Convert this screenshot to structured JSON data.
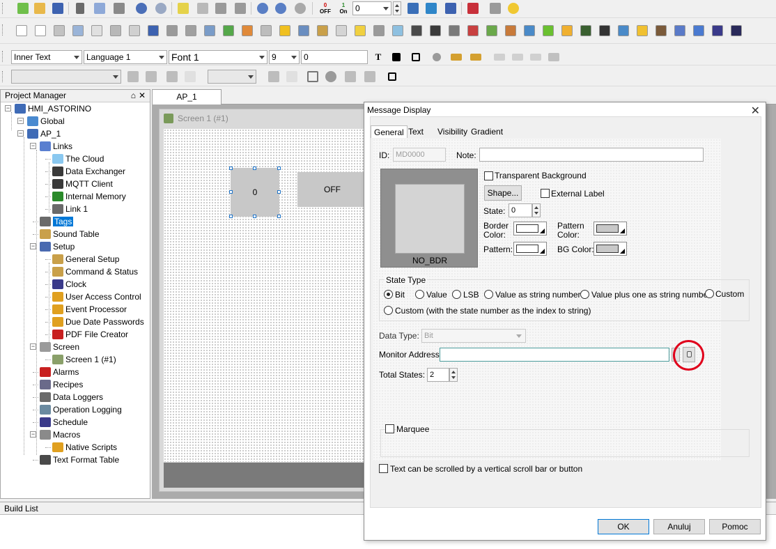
{
  "colors": {
    "accent": "#0078d7",
    "highlight_circle": "#e0001b",
    "widget_gray": "#c8c8c8",
    "canvas_foot": "#7a7a7a"
  },
  "toolbar1": {
    "icons": [
      "new-icon",
      "open-icon",
      "save-icon",
      "cut-icon",
      "copy-icon",
      "paste-icon",
      "undo-icon",
      "redo-icon",
      "add-screen-icon",
      "screen-icon",
      "screen-prev-icon",
      "screen-next-icon",
      "zoom-in-icon",
      "zoom-out-icon",
      "zoom-reset-icon",
      "state-off-icon",
      "state-on-icon"
    ],
    "state_off_label": "OFF",
    "state_off_top": "0",
    "state_on_label": "On",
    "state_on_top": "1",
    "state_combo_value": "0"
  },
  "toolbar3": {
    "text_type": "Inner Text",
    "language": "Language 1",
    "font": "Font 1",
    "font_size": "9",
    "value": "0",
    "bold_label": "T"
  },
  "project_manager": {
    "title": "Project Manager",
    "pin": "⌂",
    "close": "✕",
    "items": [
      {
        "label": "HMI_ASTORINO"
      },
      {
        "label": "Global"
      },
      {
        "label": "AP_1"
      },
      {
        "label": "Links"
      },
      {
        "label": "The Cloud"
      },
      {
        "label": "Data Exchanger"
      },
      {
        "label": "MQTT Client"
      },
      {
        "label": "Internal Memory"
      },
      {
        "label": "Link 1"
      },
      {
        "label": "Tags"
      },
      {
        "label": "Sound Table"
      },
      {
        "label": "Setup"
      },
      {
        "label": "General Setup"
      },
      {
        "label": "Command & Status"
      },
      {
        "label": "Clock"
      },
      {
        "label": "User Access Control"
      },
      {
        "label": "Event Processor"
      },
      {
        "label": "Due Date Passwords"
      },
      {
        "label": "PDF File Creator"
      },
      {
        "label": "Screen"
      },
      {
        "label": "Screen 1 (#1)"
      },
      {
        "label": "Alarms"
      },
      {
        "label": "Recipes"
      },
      {
        "label": "Data Loggers"
      },
      {
        "label": "Operation Logging"
      },
      {
        "label": "Schedule"
      },
      {
        "label": "Macros"
      },
      {
        "label": "Native Scripts"
      },
      {
        "label": "Text Format Table"
      }
    ]
  },
  "doc_tab": "AP_1",
  "screen_window": {
    "title": "Screen 1 (#1)",
    "widget_value": "0",
    "widget_off": "OFF"
  },
  "build_list": {
    "title": "Build List"
  },
  "dialog": {
    "title": "Message Display",
    "close": "✕",
    "tabs": [
      "General",
      "Text",
      "Visibility",
      "Gradient"
    ],
    "id_label": "ID:",
    "id_value": "MD0000",
    "note_label": "Note:",
    "note_value": "",
    "preview_label": "NO_BDR",
    "transparent_bg": "Transparent Background",
    "shape_button": "Shape...",
    "external_label": "External Label",
    "state_label": "State:",
    "state_value": "0",
    "border_color_label": "Border Color:",
    "pattern_color_label": "Pattern Color:",
    "pattern_label": "Pattern:",
    "bg_color_label": "BG Color:",
    "state_type_title": "State Type",
    "state_types": [
      "Bit",
      "Value",
      "LSB",
      "Value as string number",
      "Value plus one as string number",
      "Custom",
      "Custom (with the state number as the index to string)"
    ],
    "selected_state_type": "Bit",
    "data_type_label": "Data Type:",
    "data_type_value": "Bit",
    "monitor_address_label": "Monitor Address:",
    "monitor_address_value": "",
    "total_states_label": "Total States:",
    "total_states_value": "2",
    "marquee_label": "Marquee",
    "scroll_label": "Text can be scrolled by a vertical scroll bar or button",
    "ok_button": "OK",
    "cancel_button": "Anuluj",
    "help_button": "Pomoc"
  }
}
